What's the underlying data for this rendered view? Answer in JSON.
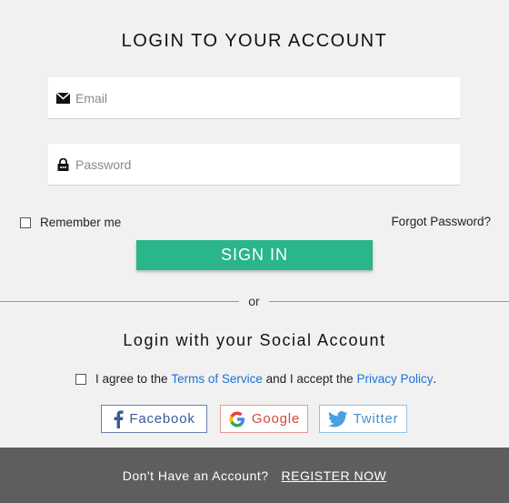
{
  "header": {
    "title": "LOGIN TO YOUR ACCOUNT"
  },
  "form": {
    "email_placeholder": "Email",
    "email_icon": "envelope-icon",
    "password_placeholder": "Password",
    "password_icon": "lock-icon",
    "remember_label": "Remember me",
    "forgot_label": "Forgot Password?",
    "signin_label": "SIGN IN"
  },
  "divider": {
    "text": "or"
  },
  "social": {
    "title": "Login with your Social Account",
    "agree_prefix": "I agree to the",
    "terms_link": "Terms of Service",
    "agree_middle": "and I accept the",
    "privacy_link": "Privacy Policy",
    "agree_suffix": ".",
    "buttons": [
      {
        "label": "Facebook",
        "icon": "facebook-icon",
        "color": "#3b5a9a"
      },
      {
        "label": "Google",
        "icon": "google-icon",
        "color": "#d04a3c"
      },
      {
        "label": "Twitter",
        "icon": "twitter-icon",
        "color": "#4a8fc9"
      }
    ]
  },
  "footer": {
    "text": "Don't Have an Account?",
    "register_label": "REGISTER NOW"
  },
  "colors": {
    "accent": "#2bb58a",
    "link": "#1a73d9",
    "footer_bg": "#5e5e5e",
    "page_bg": "#f1f1f1"
  }
}
